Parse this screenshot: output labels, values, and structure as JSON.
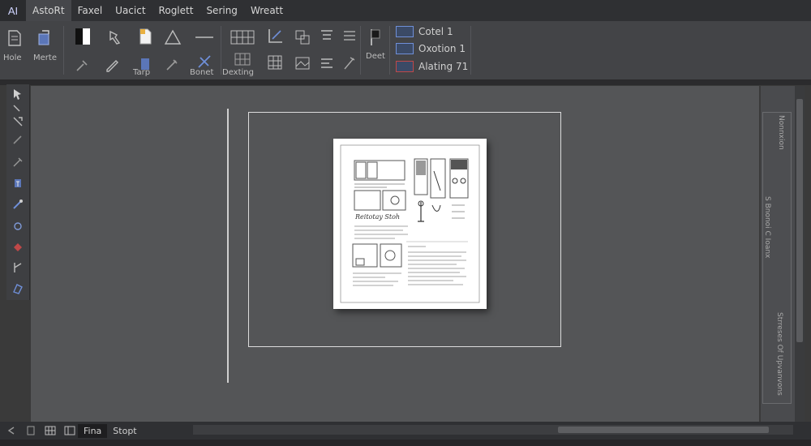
{
  "menubar": {
    "logo": "AI",
    "items": [
      "AstoRt",
      "Faxel",
      "Uacict",
      "Roglett",
      "Sering",
      "Wreatt"
    ]
  },
  "ribbon": {
    "labels": {
      "hole": "Hole",
      "morte": "Merte",
      "tarp": "Tarp",
      "bonet": "Bonet",
      "dexting": "Dexting",
      "deet": "Deet"
    },
    "styles": [
      "Cotel 1",
      "Oxotion 1",
      "Alating 71"
    ]
  },
  "document": {
    "heading": "Reitotay Stoh"
  },
  "right_panel": {
    "text_top": "Nonnxion",
    "text_mid": "S Bnonoi C Ioanx",
    "text_bottom": "Strreses Of Upvanvons"
  },
  "statusbar": {
    "tabs": [
      "Fina",
      "Stopt"
    ]
  },
  "colors": {
    "accent": "#6f8fd8",
    "background": "#3a3a3a",
    "canvas": "#545557"
  }
}
